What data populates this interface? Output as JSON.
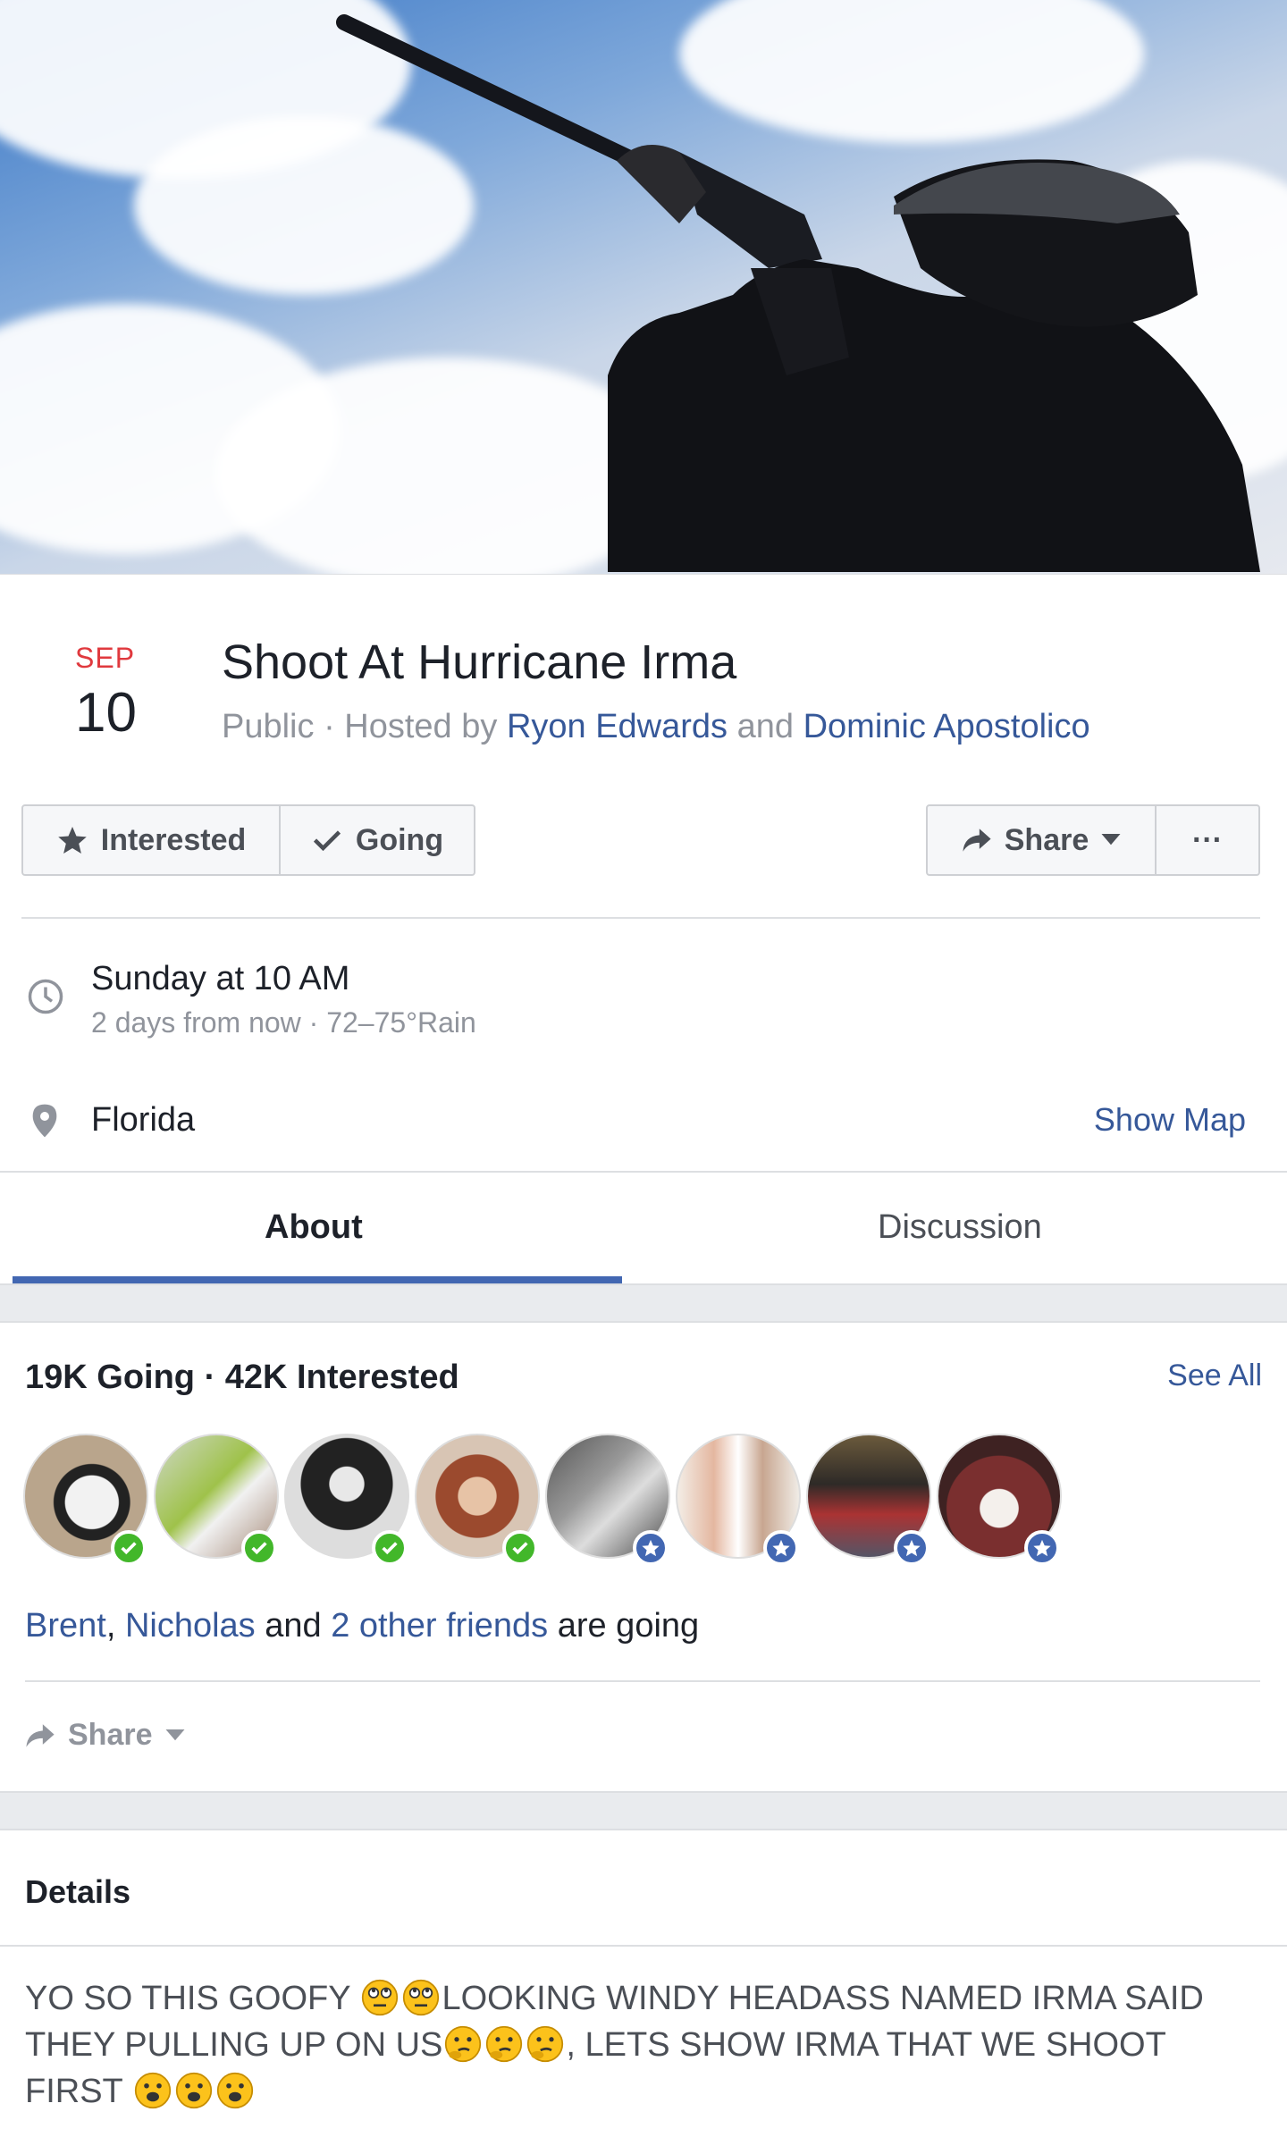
{
  "event": {
    "month": "SEP",
    "day": "10",
    "title": "Shoot At Hurricane Irma",
    "privacy": "Public",
    "hosted_by_label": "Hosted by",
    "host_1": "Ryon Edwards",
    "and_label": "and",
    "host_2": "Dominic Apostolico"
  },
  "actions": {
    "interested_label": "Interested",
    "going_label": "Going",
    "share_label": "Share",
    "more_label": "···"
  },
  "time": {
    "primary": "Sunday at 10 AM",
    "secondary": "2 days from now · 72–75°Rain"
  },
  "location": {
    "name": "Florida",
    "show_map_label": "Show Map"
  },
  "tabs": [
    {
      "label": "About",
      "active": true
    },
    {
      "label": "Discussion",
      "active": false
    }
  ],
  "guests": {
    "stats": "19K Going · 42K Interested",
    "see_all_label": "See All",
    "friend_1": "Brent",
    "friend_2": "Nicholas",
    "and_label": "and",
    "others": "2 other friends",
    "suffix": "are going",
    "avatars": [
      "going",
      "going",
      "going",
      "going",
      "interested",
      "interested",
      "interested",
      "interested"
    ]
  },
  "share_small_label": "Share",
  "details": {
    "title": "Details",
    "text_part_1": "YO SO THIS GOOFY",
    "text_part_2": "LOOKING WINDY HEADASS NAMED IRMA SAID THEY PULLING UP ON US",
    "text_part_3": ", LETS SHOW IRMA THAT WE SHOOT FIRST"
  },
  "colors": {
    "link": "#365899",
    "accent": "#4267b2",
    "date_red": "#e0393e",
    "going_green": "#42b72a"
  }
}
